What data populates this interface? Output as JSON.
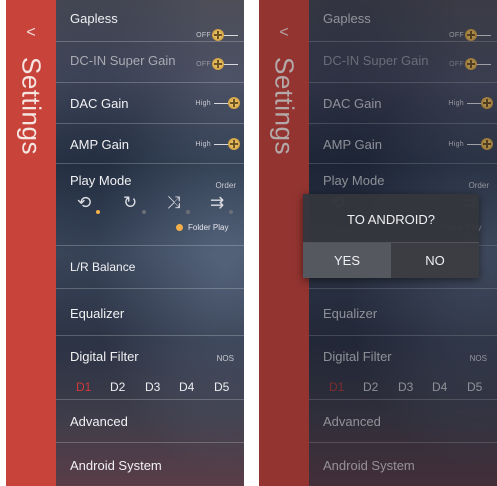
{
  "sidebar": {
    "back_glyph": "<",
    "title": "Settings"
  },
  "settings": {
    "gapless": {
      "label": "Gapless",
      "state": "OFF"
    },
    "dc_in": {
      "label": "DC-IN Super Gain",
      "state": "OFF"
    },
    "dac_gain": {
      "label": "DAC Gain",
      "state": "High"
    },
    "amp_gain": {
      "label": "AMP Gain",
      "state": "High"
    },
    "play_mode": {
      "label": "Play Mode",
      "value": "Order",
      "icons": [
        "repeat-one",
        "repeat-all",
        "shuffle",
        "order"
      ],
      "icon_glyphs": [
        "⟲",
        "↻",
        "⤨",
        "⇉"
      ],
      "folder_play": "Folder Play"
    },
    "lr_balance": {
      "label": "L/R Balance"
    },
    "equalizer": {
      "label": "Equalizer"
    },
    "digital_filter": {
      "label": "Digital Filter",
      "value": "NOS",
      "options": [
        "D1",
        "D2",
        "D3",
        "D4",
        "D5"
      ],
      "selected": "D1"
    },
    "advanced": {
      "label": "Advanced"
    },
    "android_system": {
      "label": "Android System"
    }
  },
  "dialog": {
    "title": "TO ANDROID?",
    "yes_label": "YES",
    "no_label": "NO"
  },
  "colors": {
    "accent_red": "#c8443b",
    "toggle_knob": "#d9a94a",
    "active_dot": "#f3b04a",
    "filter_active": "#d23a35"
  }
}
